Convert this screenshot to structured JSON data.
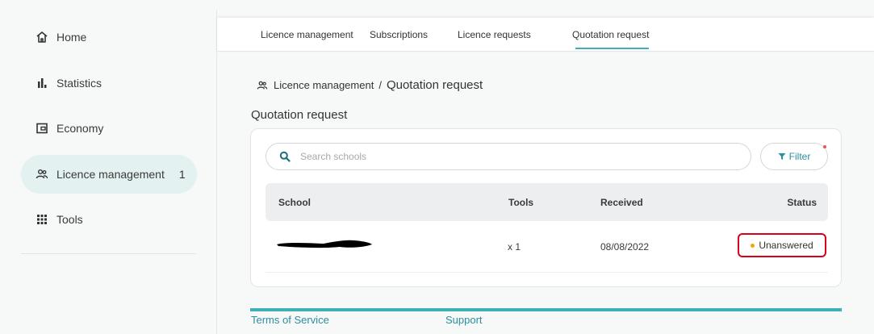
{
  "sidebar": {
    "items": [
      {
        "label": "Home",
        "icon": "home-icon"
      },
      {
        "label": "Statistics",
        "icon": "bar-chart-icon"
      },
      {
        "label": "Economy",
        "icon": "wallet-icon"
      },
      {
        "label": "Licence management",
        "icon": "users-icon",
        "count": "1",
        "active": true
      },
      {
        "label": "Tools",
        "icon": "grid-icon"
      }
    ]
  },
  "tabs": [
    {
      "label": "Licence management"
    },
    {
      "label": "Subscriptions"
    },
    {
      "label": "Licence requests"
    },
    {
      "label": "Quotation request",
      "active": true
    }
  ],
  "breadcrumb": {
    "parent": "Licence management",
    "separator": "/",
    "current": "Quotation request"
  },
  "page_title": "Quotation request",
  "search": {
    "placeholder": "Search schools",
    "value": ""
  },
  "filter": {
    "label": "Filter"
  },
  "table": {
    "columns": [
      "School",
      "Tools",
      "Received",
      "Status"
    ],
    "rows": [
      {
        "school": "",
        "tools": "x 1",
        "received": "08/08/2022",
        "status": "Unanswered"
      }
    ]
  },
  "footer": {
    "links": [
      "Terms of Service",
      "Support"
    ]
  },
  "colors": {
    "accent": "#3fb0b7",
    "link": "#2b8fa0",
    "active_nav_bg": "#e3f1f1",
    "status_dot": "#f0a500",
    "highlight_box": "#d9001b"
  }
}
